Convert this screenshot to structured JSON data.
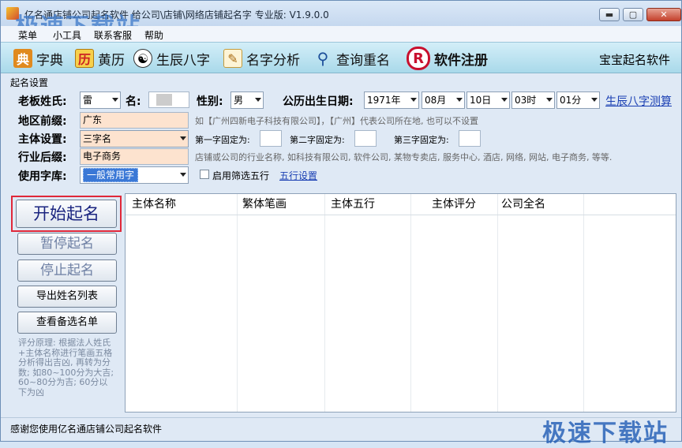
{
  "window": {
    "title": "亿名通店铺公司起名软件 给公司\\店铺\\网络店铺起名字 专业版: V1.9.0.0",
    "watermark": "极速下载站"
  },
  "menu": [
    "菜单",
    "小工具",
    "联系客服",
    "帮助"
  ],
  "toolbar": {
    "buttons": [
      {
        "label": "字典",
        "icon": "book-icon"
      },
      {
        "label": "黄历",
        "icon": "calendar-icon"
      },
      {
        "label": "生辰八字",
        "icon": "yin-yang-icon"
      },
      {
        "label": "名字分析",
        "icon": "notepad-icon"
      },
      {
        "label": "查询重名",
        "icon": "magnifier-icon"
      },
      {
        "label": "软件注册",
        "icon": "registered-icon"
      }
    ],
    "right_label": "宝宝起名软件"
  },
  "settings": {
    "group_title": "起名设置",
    "surname_label": "老板姓氏:",
    "surname_value": "雷",
    "name_label": "名:",
    "name_value": "",
    "gender_label": "性别:",
    "gender_value": "男",
    "birth_label": "公历出生日期:",
    "year": "1971年",
    "month": "08月",
    "day": "10日",
    "hour": "03时",
    "minute": "01分",
    "bazi_link": "生辰八字测算",
    "region_label": "地区前缀:",
    "region_value": "广东",
    "region_hint": "如【广州四新电子科技有限公司】，【广州】代表公司所在地, 也可以不设置",
    "subject_label": "主体设置:",
    "subject_value": "三字名",
    "fixed1_label": "第一字固定为:",
    "fixed2_label": "第二字固定为:",
    "fixed3_label": "第三字固定为:",
    "industry_label": "行业后缀:",
    "industry_value": "电子商务",
    "industry_hint": "店铺或公司的行业名称, 如科技有限公司, 软件公司, 某物专卖店, 服务中心, 酒店, 网络, 网站, 电子商务, 等等.",
    "charset_label": "使用字库:",
    "charset_value": "一般常用字",
    "wuxing_filter_label": "启用筛选五行",
    "wuxing_link": "五行设置"
  },
  "actions": {
    "start": "开始起名",
    "pause": "暂停起名",
    "stop": "停止起名",
    "export": "导出姓名列表",
    "view": "查看备选名单"
  },
  "note": "评分原理: 根据法人姓氏+主体名称进行笔画五格分析得出吉凶, 再转为分数; 如80~100分为大吉; 60~80分为吉; 60分以下为凶",
  "table": {
    "columns": [
      "主体名称",
      "繁体笔画",
      "主体五行",
      "主体评分",
      "公司全名"
    ]
  },
  "status": "感谢您使用亿名通店铺公司起名软件"
}
